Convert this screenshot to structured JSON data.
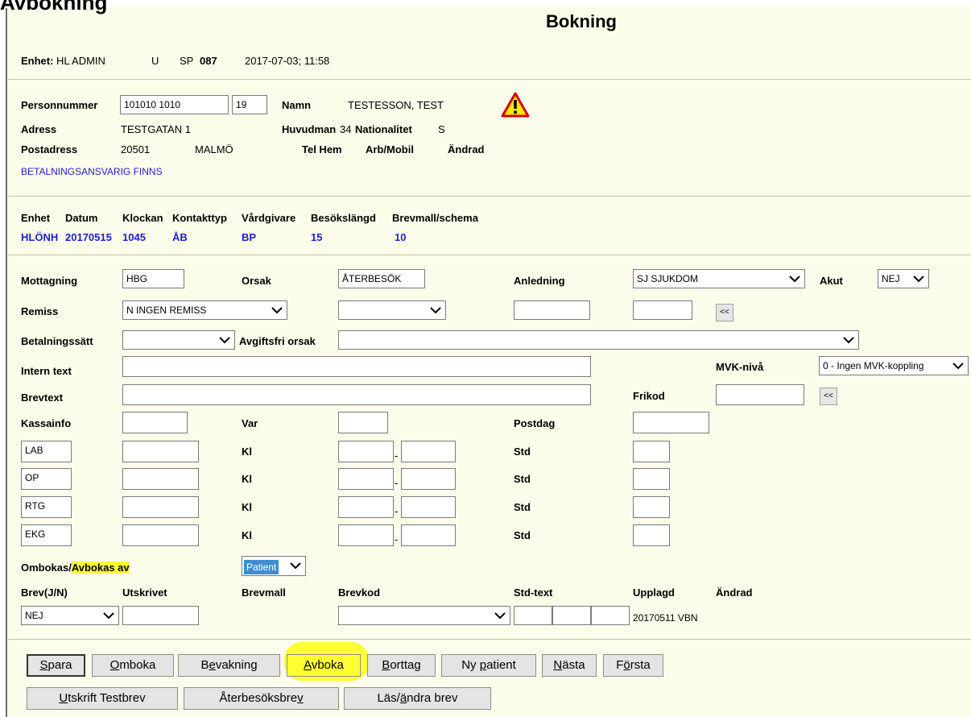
{
  "window": {
    "top_title": "Avbokning",
    "page_title": "Bokning"
  },
  "header": {
    "enhet_label": "Enhet:",
    "enhet_value": "HL ADMIN",
    "u": "U",
    "sp_label": "SP",
    "sp_value": "087",
    "datetime": "2017-07-03; 11:58"
  },
  "patient": {
    "personnummer_label": "Personnummer",
    "personnummer_value": "101010 1010",
    "century_value": "19",
    "namn_label": "Namn",
    "namn_value": "TESTESSON, TEST",
    "adress_label": "Adress",
    "adress_value": "TESTGATAN 1",
    "huvudman_label": "Huvudman",
    "huvudman_value": "34",
    "nationalitet_label": "Nationalitet",
    "nationalitet_value": "S",
    "postadress_label": "Postadress",
    "postnr": "20501",
    "ort": "MALMÖ",
    "telhem_label": "Tel Hem",
    "arbmobil_label": "Arb/Mobil",
    "andrad_label": "Ändrad",
    "betalning_note": "BETALNINGSANSVARIG FINNS",
    "warning_icon": "warning-triangle-icon"
  },
  "booking": {
    "headers": [
      "Enhet",
      "Datum",
      "Klockan",
      "Kontakttyp",
      "Vårdgivare",
      "Besökslängd",
      "Brevmall/schema"
    ],
    "values": {
      "enhet": "HLÖNH",
      "datum": "20170515",
      "klockan": "1045",
      "kontakttyp": "ÅB",
      "vardgivare": "BP",
      "besokslangd": "15",
      "brevmall": "10"
    }
  },
  "form": {
    "mottagning_label": "Mottagning",
    "mottagning_value": "HBG",
    "orsak_label": "Orsak",
    "orsak_value": "ÅTERBESÖK",
    "anledning_label": "Anledning",
    "anledning_value": "SJ SJUKDOM",
    "akut_label": "Akut",
    "akut_value": "NEJ",
    "remiss_label": "Remiss",
    "remiss_value": "N INGEN REMISS",
    "back_btn": "<<",
    "betalningssatt_label": "Betalningssätt",
    "avgiftsfri_label": "Avgiftsfri orsak",
    "intern_label": "Intern text",
    "mvk_label": "MVK-nivå",
    "mvk_value": "0 - Ingen MVK-koppling",
    "brevtext_label": "Brevtext",
    "frikod_label": "Frikod",
    "kassainfo_label": "Kassainfo",
    "var_label": "Var",
    "postdag_label": "Postdag",
    "rows": [
      {
        "code": "LAB",
        "kl": "Kl",
        "std": "Std"
      },
      {
        "code": "OP",
        "kl": "Kl",
        "std": "Std"
      },
      {
        "code": "RTG",
        "kl": "Kl",
        "std": "Std"
      },
      {
        "code": "EKG",
        "kl": "Kl",
        "std": "Std"
      }
    ],
    "ombokas_label": "Ombokas/",
    "avbokas_label": "Avbokas av",
    "avbokas_value": "Patient",
    "brev_headers": [
      "Brev(J/N)",
      "Utskrivet",
      "Brevmall",
      "Brevkod",
      "Std-text",
      "Upplagd",
      "Ändrad"
    ],
    "brev_value": "NEJ",
    "upplagd_value": "20170511 VBN"
  },
  "buttons": {
    "row1": [
      {
        "pre": "",
        "u": "S",
        "post": "para"
      },
      {
        "pre": "",
        "u": "O",
        "post": "mboka"
      },
      {
        "pre": "B",
        "u": "e",
        "post": "vakning"
      },
      {
        "pre": "",
        "u": "A",
        "post": "vboka"
      },
      {
        "pre": "",
        "u": "B",
        "post": "orttag"
      },
      {
        "pre": "Ny ",
        "u": "p",
        "post": "atient"
      },
      {
        "pre": "",
        "u": "N",
        "post": "ästa"
      },
      {
        "pre": "F",
        "u": "ö",
        "post": "rsta"
      }
    ],
    "row2": [
      {
        "pre": "",
        "u": "U",
        "post": "tskrift Testbrev"
      },
      {
        "pre": "Återbesöksbre",
        "u": "v",
        "post": ""
      },
      {
        "pre": "Läs/",
        "u": "ä",
        "post": "ndra brev"
      }
    ]
  },
  "colors": {
    "panel": "#fcfcea",
    "highlight": "#ffff33",
    "blue_text": "#1e1ed0",
    "selected": "#3d8fd1"
  }
}
